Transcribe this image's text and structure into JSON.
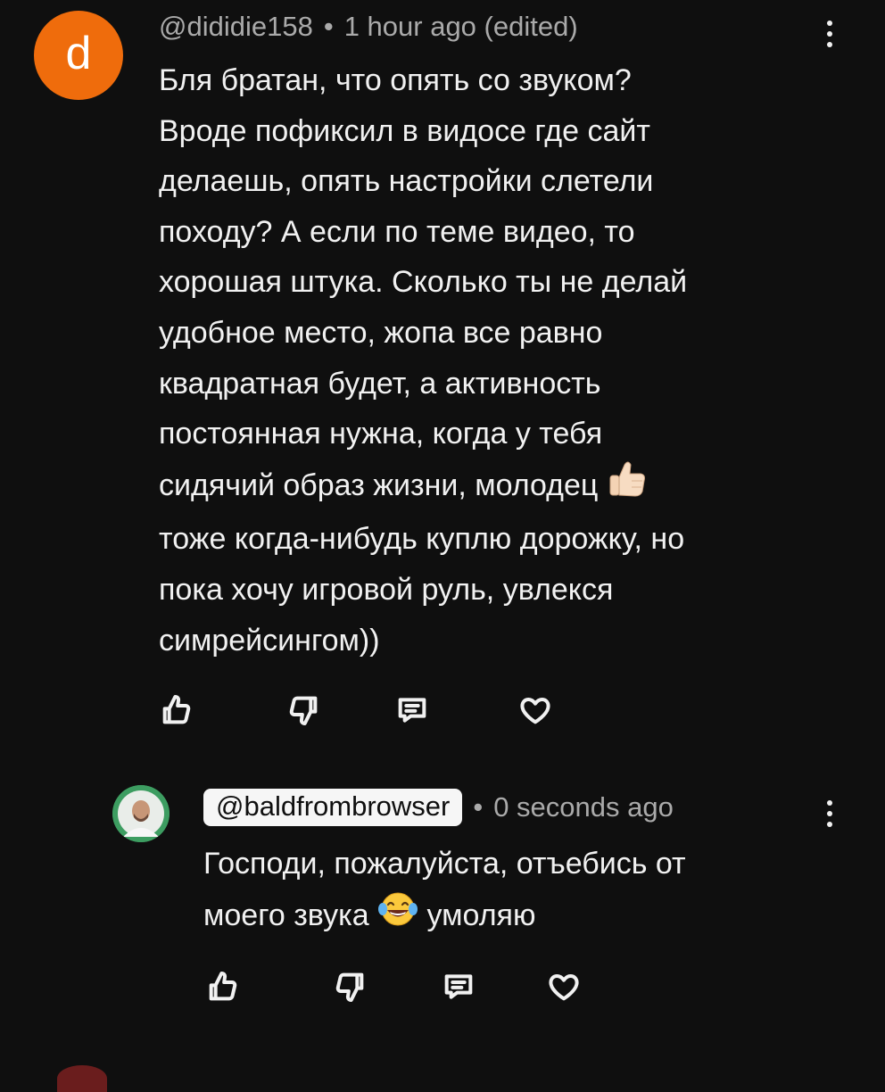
{
  "comments": [
    {
      "avatar_letter": "d",
      "avatar_color": "#ef6c0c",
      "handle": "@dididie158",
      "separator": "•",
      "time": "1 hour ago (edited)",
      "text_part1": "Бля братан, что опять со звуком?\nВроде пофиксил в видосе где сайт\nделаешь, опять настройки слетели\nпоходу? А если по теме видео, то\nхорошая штука. Сколько ты не делай\nудобное место, жопа все равно\nквадратная будет, а активность\nпостоянная нужна, когда у тебя\nсидячий образ жизни, молодец ",
      "emoji_1": "thumbs-up-emoji",
      "text_part2": "\nтоже когда-нибудь куплю дорожку, но\nпока хочу игровой руль, увлекся\nсимрейсингом))"
    },
    {
      "avatar_color": "#3d9d61",
      "handle": "@baldfrombrowser",
      "separator": "•",
      "time": "0 seconds ago",
      "text_part1": "Господи, пожалуйста, отъебись от\nмоего звука ",
      "emoji_1": "laughing-tears-emoji",
      "text_part2": " умоляю"
    }
  ],
  "icons": {
    "like": "thumbs-up-icon",
    "dislike": "thumbs-down-icon",
    "reply": "reply-comment-icon",
    "heart": "heart-icon",
    "more": "more-vertical-icon"
  },
  "colors": {
    "background": "#0f0f0f",
    "text": "#f1f1f1",
    "meta": "#aaaaaa",
    "chip": "#f6f6f6"
  }
}
